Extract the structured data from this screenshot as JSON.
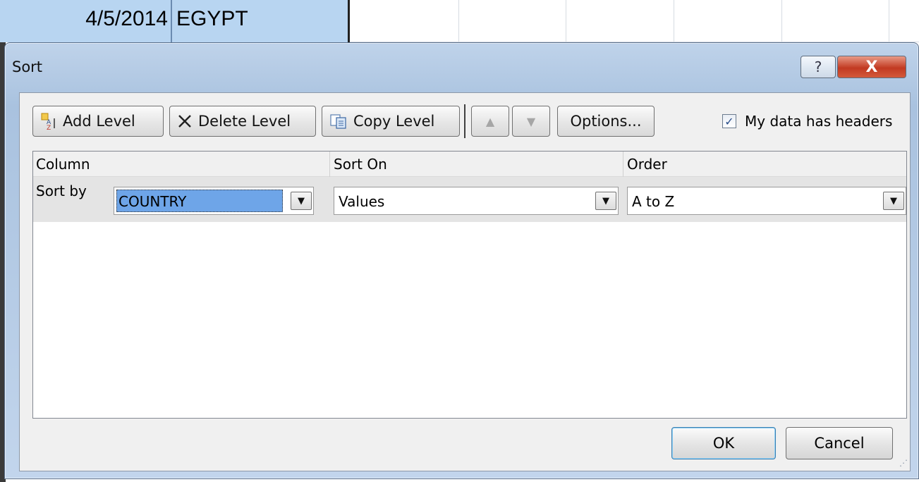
{
  "sheet": {
    "row": {
      "date": "4/5/2014",
      "country": "EGYPT"
    }
  },
  "dialog": {
    "title": "Sort",
    "help_glyph": "?",
    "close_glyph": "X",
    "toolbar": {
      "add_level": "Add Level",
      "delete_level": "Delete Level",
      "copy_level": "Copy Level",
      "move_up_glyph": "▲",
      "move_down_glyph": "▼",
      "options": "Options...",
      "headers_label": "My data has headers",
      "headers_checked": true
    },
    "columns": {
      "column": "Column",
      "sort_on": "Sort On",
      "order": "Order"
    },
    "level": {
      "label": "Sort by",
      "column_value": "COUNTRY",
      "sort_on_value": "Values",
      "order_value": "A to Z"
    },
    "ok": "OK",
    "cancel": "Cancel"
  }
}
